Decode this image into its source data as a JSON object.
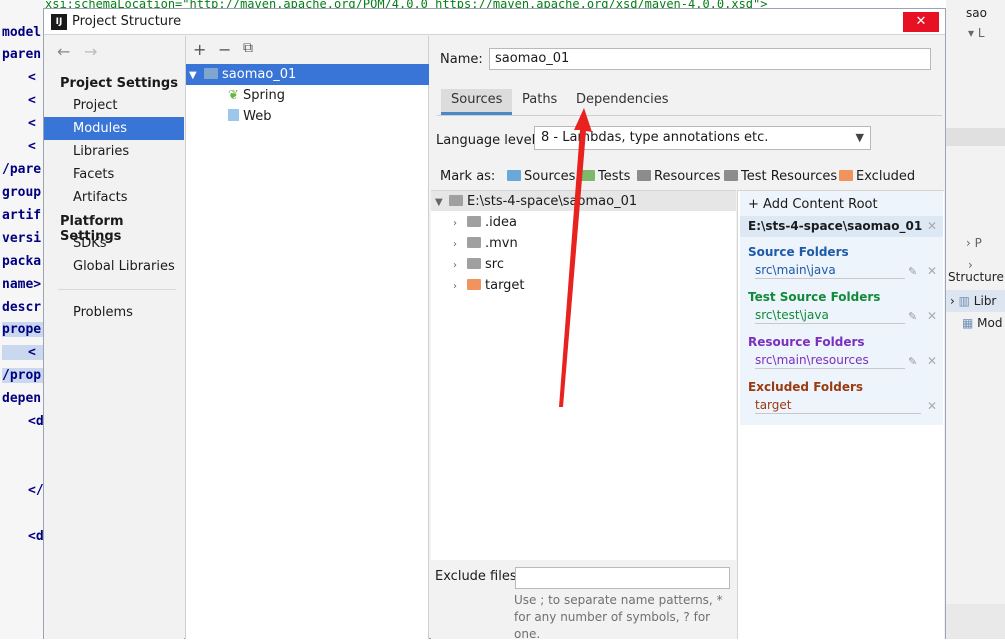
{
  "editor": {
    "top_text": "xsi:schemaLocation=\"http://maven.apache.org/POM/4.0.0 https://maven.apache.org/xsd/maven-4.0.0.xsd\">",
    "lines": [
      "model",
      "paren",
      "<",
      "<",
      "<",
      "<",
      "/pare",
      "group",
      "artif",
      "versi",
      "packa",
      "name>",
      "descr",
      "prope",
      "<",
      "/prop",
      "depen",
      "<d",
      "",
      "</",
      "",
      "<d"
    ]
  },
  "right_bg": {
    "item1": "sao",
    "item2": "L",
    "item3": "P",
    "structure_label": "Structure",
    "libraries": "Libr",
    "modules": "Mod"
  },
  "dialog": {
    "title": "Project Structure",
    "app_icon": "IJ",
    "close": "✕"
  },
  "nav": {
    "back": "←",
    "forward": "→",
    "project_settings": "Project Settings",
    "items1": [
      "Project",
      "Modules",
      "Libraries",
      "Facets",
      "Artifacts"
    ],
    "platform_settings": "Platform Settings",
    "items2": [
      "SDKs",
      "Global Libraries"
    ],
    "problems": "Problems"
  },
  "modules": {
    "add": "+",
    "remove": "−",
    "copy": "⧉",
    "root": "saomao_01",
    "children": [
      "Spring",
      "Web"
    ]
  },
  "content": {
    "name_label": "Name:",
    "name_value": "saomao_01",
    "tabs": [
      "Sources",
      "Paths",
      "Dependencies"
    ],
    "language_label": "Language level:",
    "language_value": "8 - Lambdas, type annotations etc.",
    "mark_as_label": "Mark as:",
    "marks": [
      "Sources",
      "Tests",
      "Resources",
      "Test Resources",
      "Excluded"
    ],
    "tree_root": "E:\\sts-4-space\\saomao_01",
    "tree_children": [
      ".idea",
      ".mvn",
      "src",
      "target"
    ],
    "add_content_root": "+ Add Content Root",
    "content_root_path": "E:\\sts-4-space\\saomao_01",
    "source_folders_label": "Source Folders",
    "source_folder": "src\\main\\java",
    "test_source_folders_label": "Test Source Folders",
    "test_source_folder": "src\\test\\java",
    "resource_folders_label": "Resource Folders",
    "resource_folder": "src\\main\\resources",
    "excluded_folders_label": "Excluded Folders",
    "excluded_folder": "target",
    "exclude_files_label": "Exclude files:",
    "exclude_files_value": "",
    "exclude_help": "Use ; to separate name patterns, * for any number of symbols, ? for one."
  },
  "colors": {
    "selection": "#3875d7",
    "source": "#1e5aa8",
    "test": "#118a3a",
    "resource": "#7b2fbe",
    "excluded": "#9a3a10",
    "annotation": "#e8231f"
  }
}
